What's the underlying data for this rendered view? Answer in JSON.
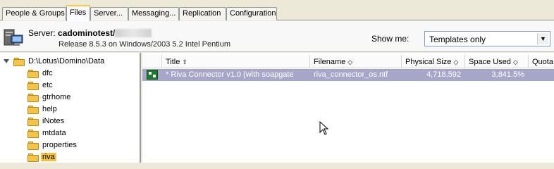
{
  "tabs": [
    {
      "label": "People & Groups",
      "active": false
    },
    {
      "label": "Files",
      "active": true
    },
    {
      "label": "Server...",
      "active": false
    },
    {
      "label": "Messaging...",
      "active": false
    },
    {
      "label": "Replication",
      "active": false
    },
    {
      "label": "Configuration",
      "active": false
    }
  ],
  "server": {
    "label": "Server:",
    "name": "cadominotest/",
    "release": "Release 8.5.3 on Windows/2003 5.2 Intel Pentium"
  },
  "show_me": {
    "label": "Show me:",
    "selected": "Templates only"
  },
  "tree": {
    "root": "D:\\Lotus\\Domino\\Data",
    "folders": [
      "dfc",
      "etc",
      "gtrhome",
      "help",
      "iNotes",
      "mtdata",
      "properties",
      "riva"
    ],
    "selected": "riva"
  },
  "grid": {
    "columns": [
      "Title",
      "Filename",
      "Physical Size",
      "Space Used",
      "Quota"
    ],
    "rows": [
      {
        "title": "* Riva Connector v1.0 (with soapgate",
        "filename": "riva_connector_os.ntf",
        "physical_size": "4,718,592",
        "space_used": "3,841.5%"
      }
    ]
  },
  "colors": {
    "selected_row": "#a6a6c9",
    "active_tab_accent": "#ffc83c",
    "folder": "#f3c44a"
  }
}
